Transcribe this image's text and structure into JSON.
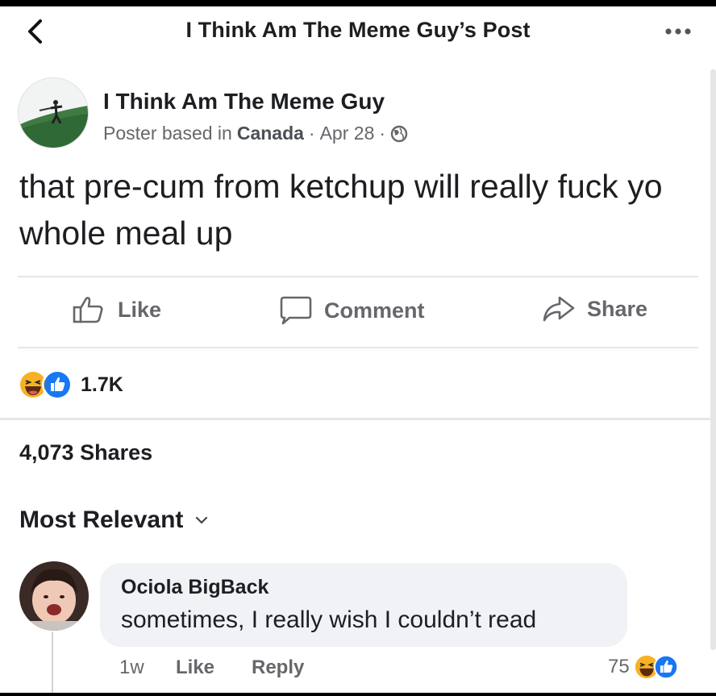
{
  "header": {
    "title": "I Think Am The Meme Guy’s Post"
  },
  "post": {
    "author": "I Think Am The Meme Guy",
    "meta_prefix": "Poster based in",
    "location": "Canada",
    "date": "Apr 28",
    "text": "that pre-cum from ketchup will really fuck yo whole meal up"
  },
  "actions": {
    "like": "Like",
    "comment": "Comment",
    "share": "Share"
  },
  "stats": {
    "reaction_count": "1.7K",
    "shares": "4,073 Shares"
  },
  "comments_sort": "Most Relevant",
  "comment": {
    "author": "Ociola BigBack",
    "text": "sometimes, I really wish I couldn’t read",
    "age": "1w",
    "like": "Like",
    "reply": "Reply",
    "reaction_count": "75"
  },
  "colors": {
    "like_blue": "#1877f2",
    "haha_yellow": "#f7b125",
    "muted": "#65676b"
  }
}
